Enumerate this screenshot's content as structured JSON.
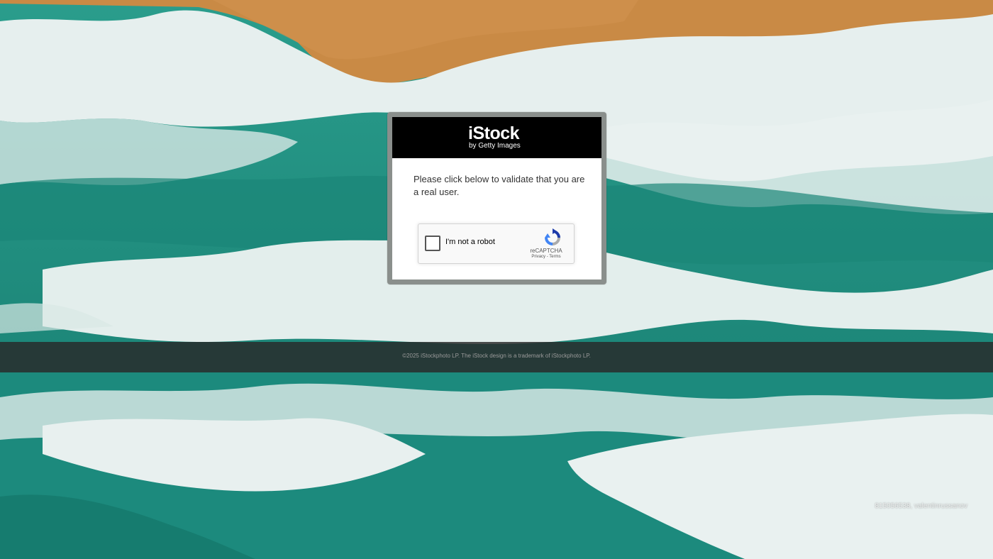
{
  "modal": {
    "logo_main": "iStock",
    "logo_sub": "by Getty Images",
    "prompt": "Please click below to validate that you are a real user."
  },
  "recaptcha": {
    "checkbox_label": "I'm not a robot",
    "brand": "reCAPTCHA",
    "privacy_label": "Privacy",
    "separator": "-",
    "terms_label": "Terms",
    "checked": false
  },
  "footer": {
    "copyright": "©2025 iStockphoto LP. The iStock design is a trademark of iStockphoto LP."
  },
  "photo_credit": "815056538, valentinrussanov",
  "colors": {
    "sand": "#c98a45",
    "sea": "#1f8c7f",
    "foam": "#e9f1f0",
    "modal_header": "#000000",
    "footer_band": "#282828"
  }
}
